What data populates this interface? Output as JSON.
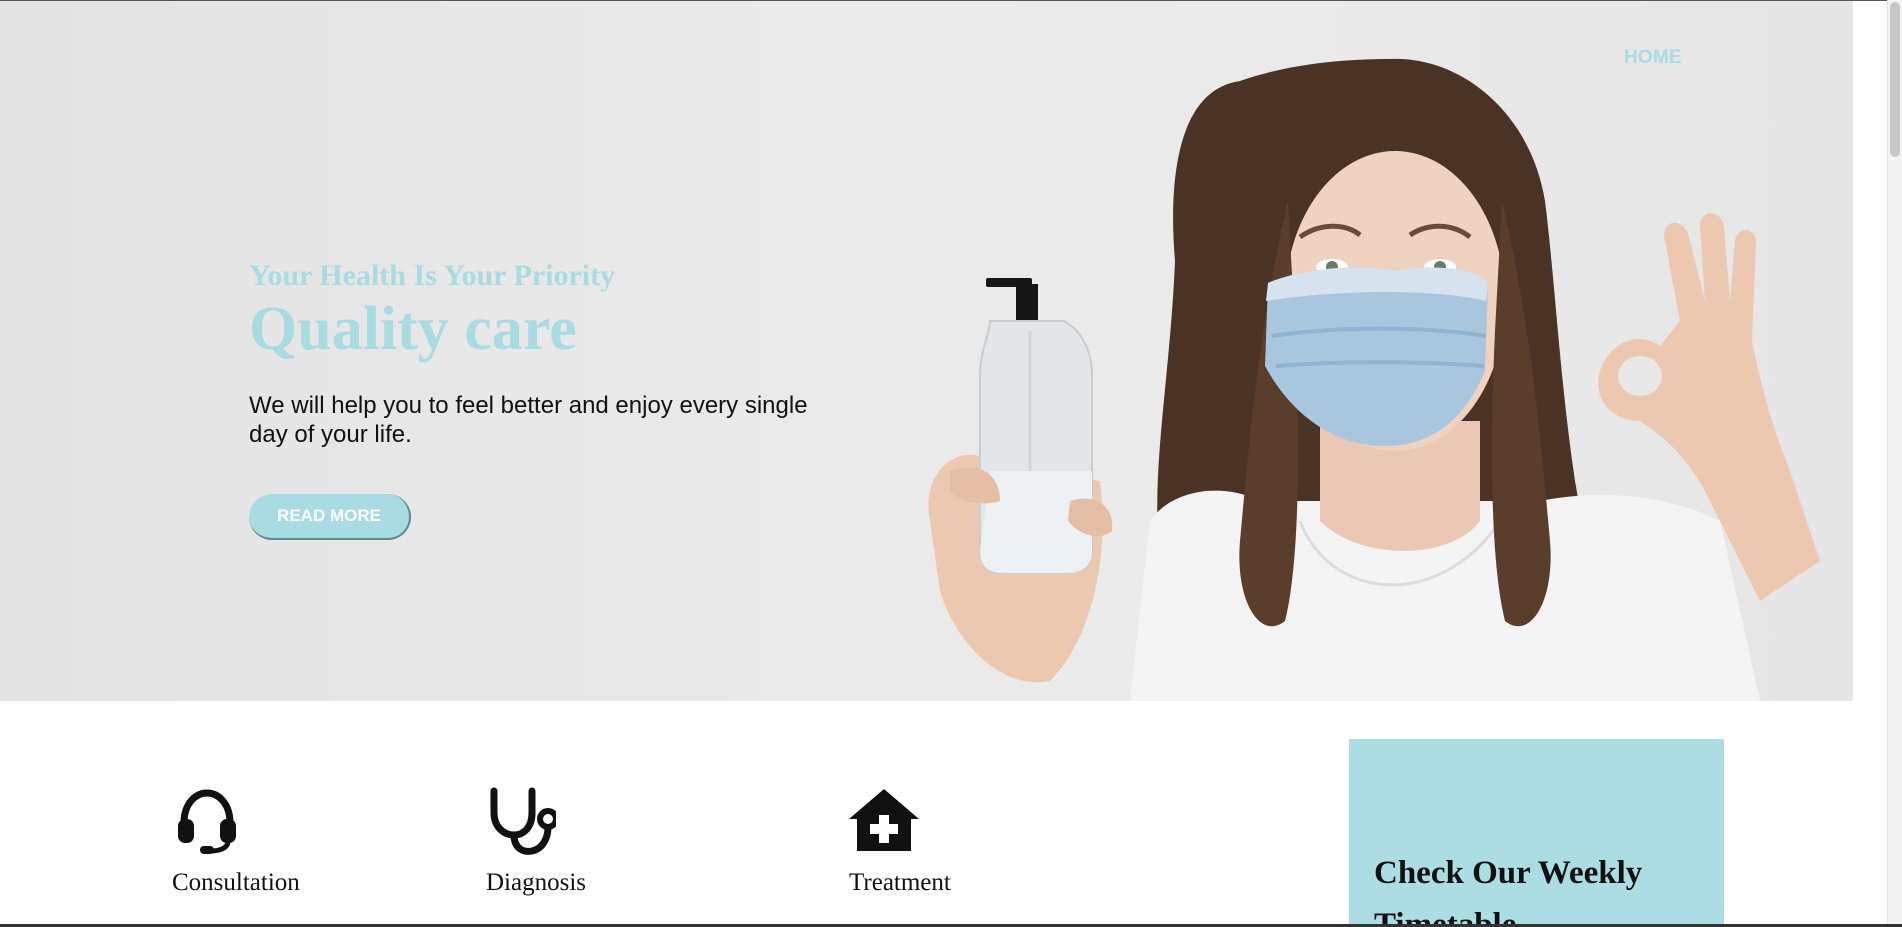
{
  "nav": {
    "home_label": "HOME"
  },
  "hero": {
    "subtitle": "Your Health Is Your Priority",
    "title": "Quality care",
    "description": "We will help you to feel better and enjoy every single day of your life.",
    "button_label": "READ MORE"
  },
  "services": [
    {
      "label": "Consultation",
      "icon": "headset-icon"
    },
    {
      "label": "Diagnosis",
      "icon": "stethoscope-icon"
    },
    {
      "label": "Treatment",
      "icon": "medical-home-icon"
    }
  ],
  "timetable": {
    "title": "Check Our Weekly Timetable"
  },
  "colors": {
    "accent": "#a9dbe3",
    "timetable_bg": "#abdde3",
    "text": "#111111"
  }
}
